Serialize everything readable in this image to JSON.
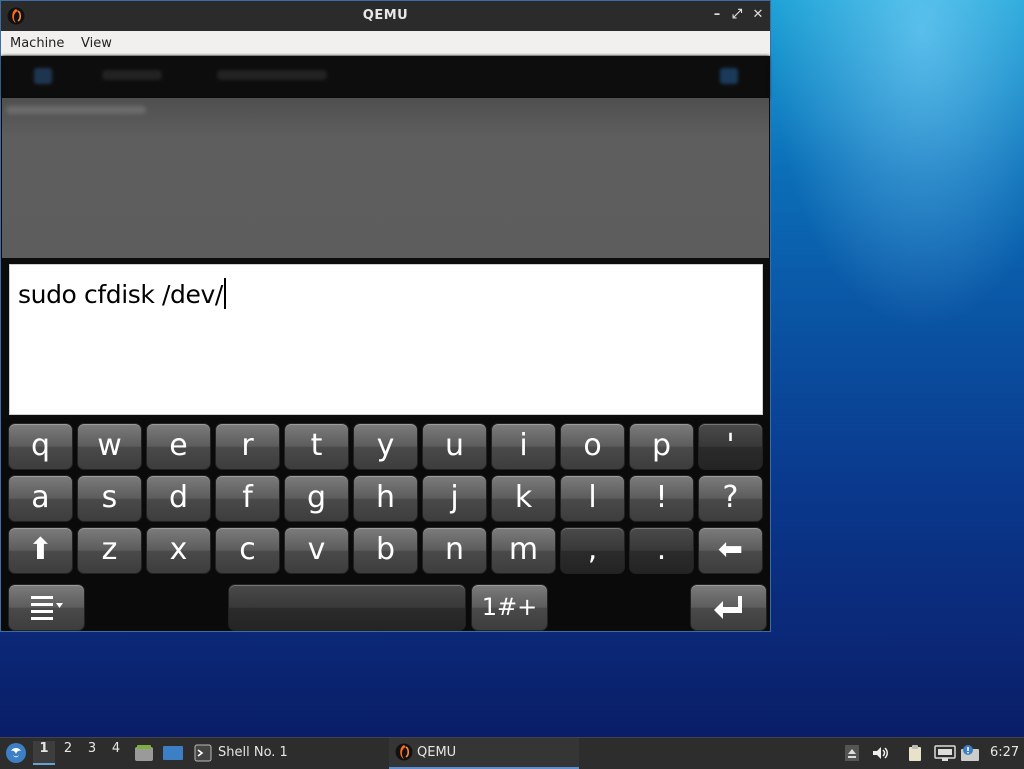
{
  "window": {
    "title": "QEMU",
    "menu": [
      "Machine",
      "View"
    ],
    "controls": {
      "minimize": "–",
      "maximize": "⤢",
      "close": "✕"
    }
  },
  "guest": {
    "input_text": "sudo cfdisk /dev/",
    "keyboard": {
      "row1": [
        "q",
        "w",
        "e",
        "r",
        "t",
        "y",
        "u",
        "i",
        "o",
        "p",
        "'"
      ],
      "row2": [
        "a",
        "s",
        "d",
        "f",
        "g",
        "h",
        "j",
        "k",
        "l",
        "!",
        "?"
      ],
      "row3": [
        "⬆",
        "z",
        "x",
        "c",
        "v",
        "b",
        "n",
        "m",
        ",",
        ".",
        "⬅"
      ],
      "row4": {
        "menu_icon": "menu-icon",
        "space": "",
        "symbols": "1#+",
        "enter_icon": "enter-icon"
      }
    }
  },
  "taskbar": {
    "workspaces": [
      "1",
      "2",
      "3",
      "4"
    ],
    "active_workspace": "1",
    "tasks": [
      "Shell No. 1",
      "QEMU"
    ],
    "clock": "6:27"
  },
  "colors": {
    "accent": "#5c8fd0",
    "window_border": "#3a6ea5"
  }
}
